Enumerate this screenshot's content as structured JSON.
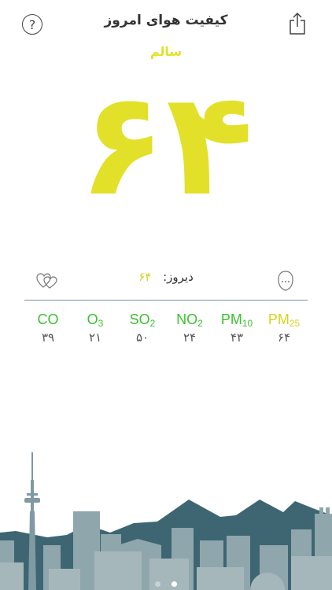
{
  "header": {
    "title": "کیفیت هوای امروز",
    "help_label": "?"
  },
  "status": {
    "label": "سالم",
    "aqi_value": "۶۴",
    "color": "#e3e02a"
  },
  "yesterday": {
    "label": "دیروز:",
    "value": "۶۴"
  },
  "pollutants": [
    {
      "name": "CO",
      "sub": "",
      "value": "۳۹",
      "color": "#3ac22f"
    },
    {
      "name": "O",
      "sub": "3",
      "value": "۲۱",
      "color": "#3ac22f"
    },
    {
      "name": "SO",
      "sub": "2",
      "value": "۵۰",
      "color": "#3ac22f"
    },
    {
      "name": "NO",
      "sub": "2",
      "value": "۲۴",
      "color": "#3ac22f"
    },
    {
      "name": "PM",
      "sub": "10",
      "value": "۴۳",
      "color": "#3ac22f"
    },
    {
      "name": "PM",
      "sub": "25",
      "value": "۶۴",
      "color": "#d6d21f"
    }
  ],
  "icons": {
    "help": "help-icon",
    "share": "share-icon",
    "favorite": "hearts-icon",
    "face": "face-icon"
  },
  "page_indicator": {
    "count": 2,
    "active": 1
  },
  "colors": {
    "divider": "#7a8f98",
    "skyline_dark": "#3d6672",
    "skyline_light": "#9aaeb3"
  }
}
